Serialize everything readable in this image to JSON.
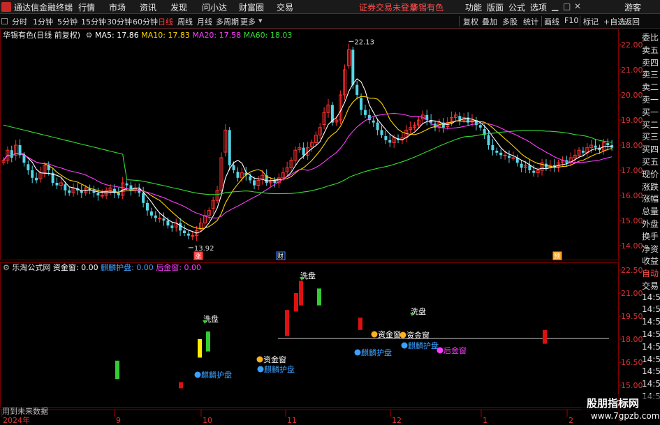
{
  "menubar": {
    "app_title": "通达信金融终端",
    "items": [
      "行情",
      "市场",
      "资讯",
      "发现",
      "问小达",
      "财富圈",
      "交易"
    ],
    "status_msg": "证券交易未登录",
    "status_stock": "华锡有色",
    "right_items": [
      "功能",
      "版面",
      "公式",
      "选项"
    ],
    "guest": "游客"
  },
  "toolbar": {
    "periods": [
      "分时",
      "1分钟",
      "5分钟",
      "15分钟",
      "30分钟",
      "60分钟",
      "日线",
      "周线",
      "月线",
      "多周期",
      "更多"
    ],
    "active_period": "日线",
    "right_tools": [
      "复权",
      "叠加",
      "多股",
      "统计",
      "画线",
      "F10",
      "标记",
      "+自选",
      "返回"
    ]
  },
  "main_chart": {
    "stock_name": "华锡有色",
    "mode": "(日线 前复权)",
    "ma": [
      {
        "label": "MA5:",
        "value": "17.86",
        "color": "#ffffff"
      },
      {
        "label": "MA10:",
        "value": "17.83",
        "color": "#ffd400"
      },
      {
        "label": "MA20:",
        "value": "17.58",
        "color": "#ff3cff"
      },
      {
        "label": "MA60:",
        "value": "18.03",
        "color": "#33dd33"
      }
    ],
    "price_ticks": [
      "22.00",
      "21.00",
      "20.00",
      "19.00",
      "18.00",
      "17.00",
      "16.00",
      "15.00",
      "14.00"
    ],
    "high_label": "22.13",
    "low_label": "13.92",
    "event_marks": [
      "涨",
      "财",
      "预"
    ]
  },
  "sub_chart": {
    "formula_site": "乐淘公式网",
    "indicators": [
      {
        "label": "资金窗:",
        "value": "0.00",
        "color": "#ffffff"
      },
      {
        "label": "麒麟护盘:",
        "value": "0.00",
        "color": "#3ca0ff"
      },
      {
        "label": "后金窗:",
        "value": "0.00",
        "color": "#ff3cff"
      }
    ],
    "ticks": [
      "22.50",
      "21.00",
      "19.50",
      "18.00",
      "16.50",
      "15.00"
    ],
    "signals": {
      "wash": "洗盘",
      "fund_window": "资金窗",
      "qilin": "麒麟护盘",
      "after_window": "后金窗"
    },
    "future_label": "用到未来数据"
  },
  "x_axis": {
    "labels": [
      "2024年",
      "9",
      "10",
      "11",
      "12",
      "1",
      "2"
    ]
  },
  "quote_panel": {
    "labels": [
      "委比",
      "卖五",
      "卖四",
      "卖三",
      "卖二",
      "卖一",
      "买一",
      "买二",
      "买三",
      "买四",
      "买五",
      "现价",
      "涨跌",
      "涨幅",
      "总量",
      "外盘",
      "换手",
      "净资",
      "收益"
    ],
    "lower": [
      "自动",
      "交易",
      "14:5",
      "14:5",
      "14:5",
      "14:5",
      "14:5",
      "14:5",
      "14:5",
      "14:5",
      "14:5"
    ]
  },
  "watermark": {
    "title": "股朋指标网",
    "url": "www.7gpzb.com"
  },
  "colors": {
    "up": "#ff3232",
    "down": "#54d6e6",
    "ma5": "#ffffff",
    "ma10": "#ffd400",
    "ma20": "#ff3cff",
    "ma60": "#33dd33",
    "grid": "#6b0000"
  }
}
